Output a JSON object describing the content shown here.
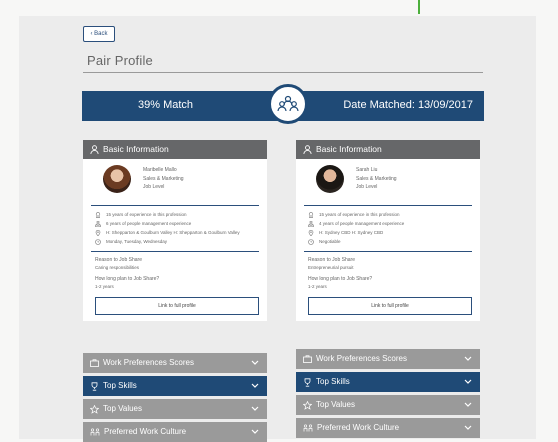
{
  "toolbar": {
    "back_label": "Back"
  },
  "page": {
    "title": "Pair Profile"
  },
  "match": {
    "percent_label": "39% Match",
    "date_label": "Date Matched: 13/09/2017"
  },
  "accordions": {
    "work_preferences": "Work Preferences Scores",
    "top_skills": "Top Skills",
    "top_values": "Top Values",
    "work_culture": "Preferred Work Culture"
  },
  "left": {
    "section_title": "Basic Information",
    "name": "Maribelle Mallo",
    "department": "Sales & Marketing",
    "level": "Job Level",
    "experience": "15 years of experience in this profession",
    "management": "6 years of people management experience",
    "locations": "H: Shepparton & Goulburn Valley   H: Shepparton & Goulburn Valley",
    "days": "Monday, Tuesday, Wednesday",
    "reason_q": "Reason to Job Share",
    "reason_a": "Caring responsibilities",
    "duration_q": "How long plan to Job Share?",
    "duration_a": "1-2 years",
    "link_label": "Link to full profile"
  },
  "right": {
    "section_title": "Basic Information",
    "name": "Sarah Liu",
    "department": "Sales & Marketing",
    "level": "Job Level",
    "experience": "15 years of experience in this profession",
    "management": "4 years of people management experience",
    "locations": "H: Sydney CBD   H: Sydney CBD",
    "days": "Negotiable",
    "reason_q": "Reason to Job Share",
    "reason_a": "Entrepreneurial pursuit",
    "duration_q": "How long plan to Job Share?",
    "duration_a": "1-2 years",
    "link_label": "Link to full profile"
  },
  "colors": {
    "navy": "#1f4a76",
    "card_header": "#666769",
    "accordion_grey": "#9a9a9a",
    "accent_green": "#4caf3c"
  }
}
